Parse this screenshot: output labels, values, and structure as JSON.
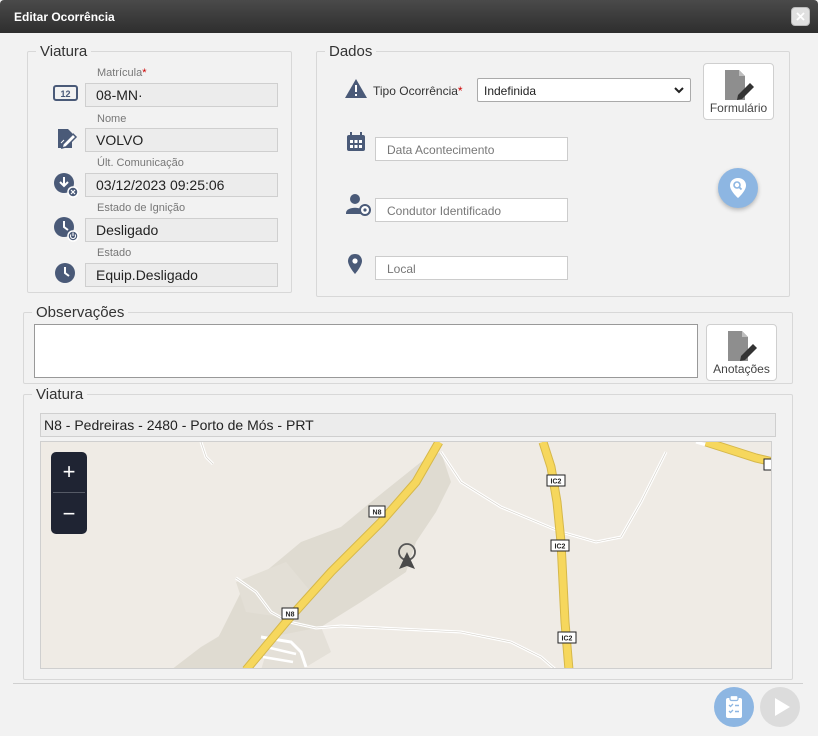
{
  "window": {
    "title": "Editar Ocorrência"
  },
  "viatura": {
    "legend": "Viatura",
    "matricula": {
      "label": "Matrícula",
      "required": "*",
      "value": "08-MN·"
    },
    "nome": {
      "label": "Nome",
      "value": "VOLVO"
    },
    "ult_comunicacao": {
      "label": "Últ. Comunicação",
      "value": "03/12/2023 09:25:06"
    },
    "estado_ignicao": {
      "label": "Estado de Ignição",
      "value": "Desligado"
    },
    "estado": {
      "label": "Estado",
      "value": "Equip.Desligado"
    },
    "icons": {
      "plate": "12"
    }
  },
  "dados": {
    "legend": "Dados",
    "tipo_ocorrencia": {
      "label": "Tipo Ocorrência",
      "required": "*",
      "value": "Indefinida"
    },
    "data_acontecimento": {
      "placeholder": "Data Acontecimento"
    },
    "condutor": {
      "placeholder": "Condutor Identificado"
    },
    "local": {
      "placeholder": "Local"
    },
    "formulario_label": "Formulário"
  },
  "observacoes": {
    "legend": "Observações",
    "value": "",
    "anotacoes_label": "Anotações"
  },
  "mapa": {
    "legend": "Viatura",
    "address": "N8 - Pedreiras - 2480 - Porto de Mós - PRT",
    "zoom_in": "+",
    "zoom_out": "−",
    "road_labels": {
      "n8": "N8",
      "ic2": "IC2"
    }
  },
  "colors": {
    "accent": "#8db6e2",
    "road": "#f5d65a",
    "titlebar": "#3a3a3a",
    "required": "#cc0000"
  }
}
